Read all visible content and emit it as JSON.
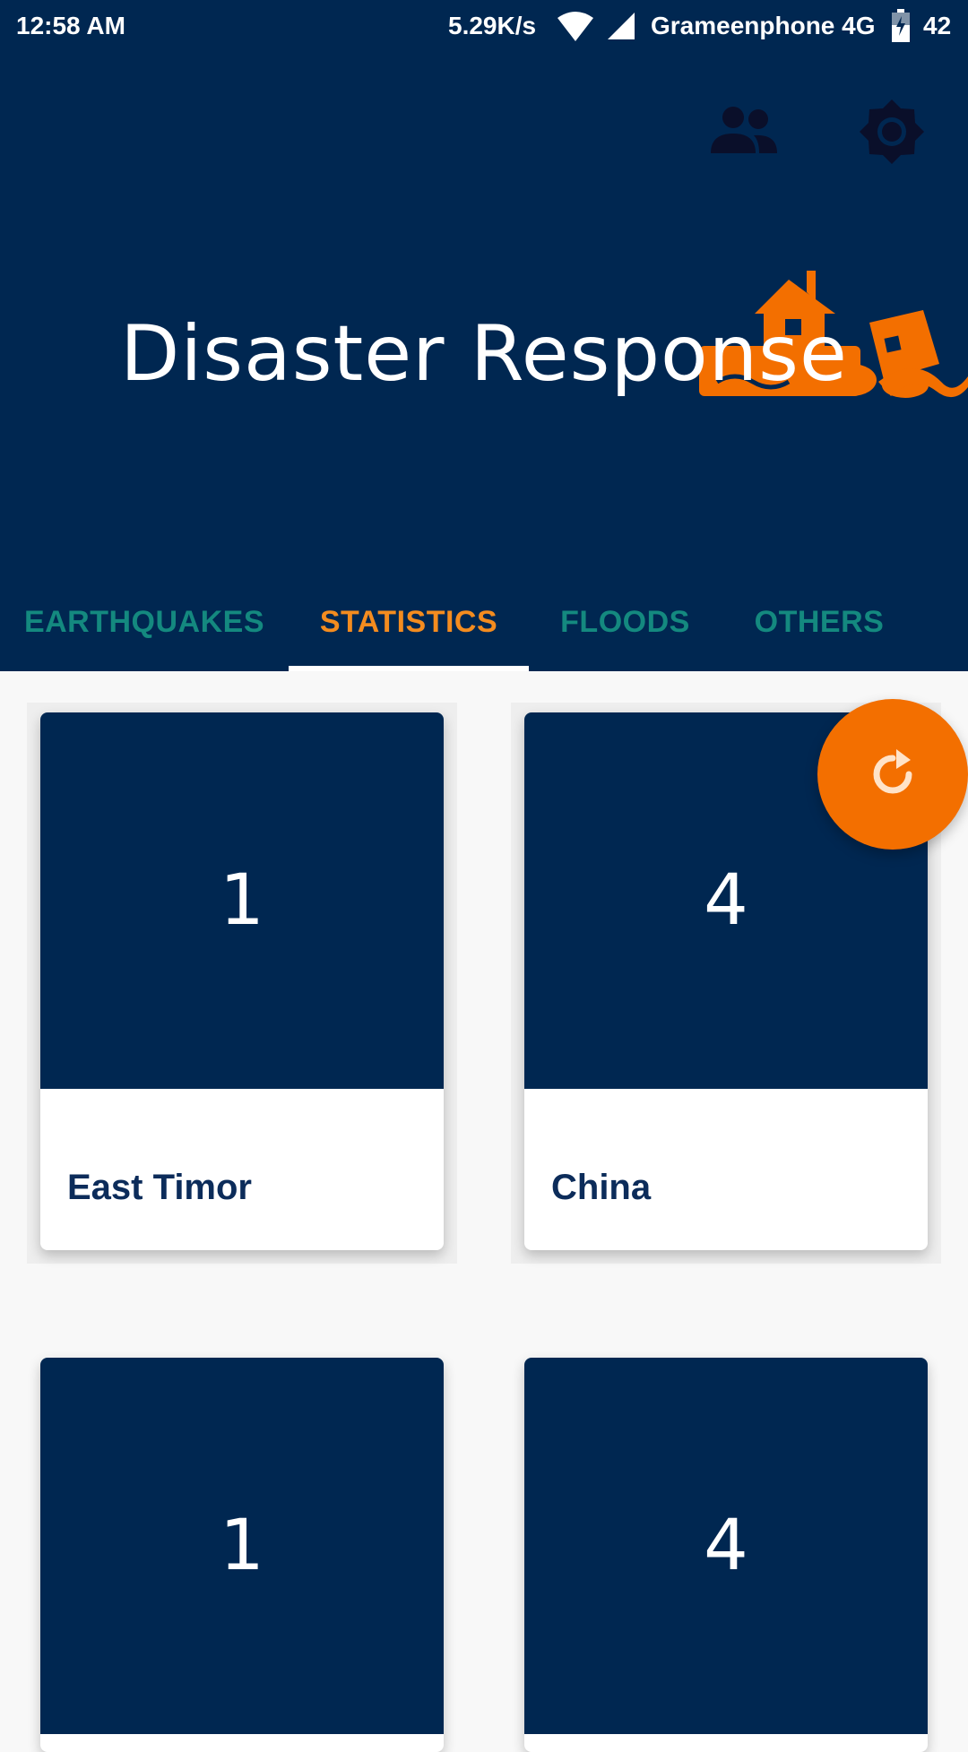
{
  "status_bar": {
    "time": "12:58 AM",
    "network_speed": "5.29K/s",
    "carrier": "Grameenphone 4G",
    "battery": "42",
    "icons": [
      "wifi-icon",
      "signal-icon",
      "battery-icon"
    ]
  },
  "header": {
    "title": "Disaster Response",
    "actions": [
      "people-icon",
      "settings-icon"
    ],
    "logo": "flood-house-logo",
    "background_color": "#002751",
    "logo_color": "#f36f00"
  },
  "tabs": [
    {
      "label": "EARTHQUAKES",
      "active": false
    },
    {
      "label": "STATISTICS",
      "active": true
    },
    {
      "label": "FLOODS",
      "active": false
    },
    {
      "label": "OTHERS",
      "active": false
    }
  ],
  "colors": {
    "active_tab": "#f48c1f",
    "inactive_tab": "#14897f",
    "card_top": "#002751",
    "fab": "#f36f00"
  },
  "cards": [
    {
      "count": "1",
      "country": "East Timor"
    },
    {
      "count": "4",
      "country": "China"
    },
    {
      "count": "1",
      "country": ""
    },
    {
      "count": "4",
      "country": ""
    }
  ],
  "fab": {
    "icon": "refresh-icon"
  }
}
